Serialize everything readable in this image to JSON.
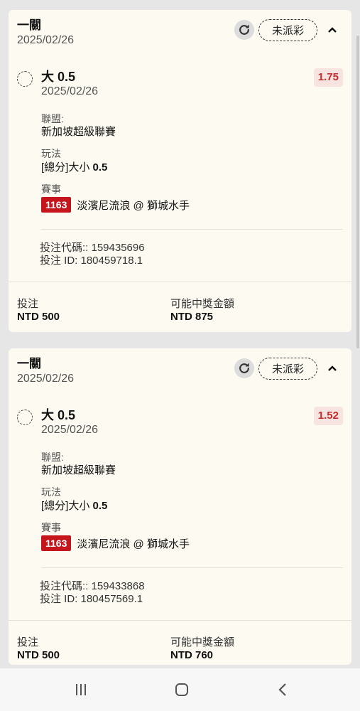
{
  "bets": [
    {
      "title": "一關",
      "date": "2025/02/26",
      "status": "未派彩",
      "selection": "大 0.5",
      "selection_date": "2025/02/26",
      "odds": "1.75",
      "league_label": "聯盟:",
      "league": "新加坡超級聯賽",
      "market_label": "玩法",
      "market_prefix": "[總分]大小",
      "market_value": "0.5",
      "event_label": "賽事",
      "event_id": "1163",
      "event_name": "淡濱尼流浪 @ 獅城水手",
      "bet_code": "投注代碼:: 159435696",
      "bet_id": "投注 ID: 180459718.1",
      "stake_label": "投注",
      "stake": "NTD 500",
      "payout_label": "可能中獎金額",
      "payout": "NTD 875"
    },
    {
      "title": "一關",
      "date": "2025/02/26",
      "status": "未派彩",
      "selection": "大 0.5",
      "selection_date": "2025/02/26",
      "odds": "1.52",
      "league_label": "聯盟:",
      "league": "新加坡超級聯賽",
      "market_label": "玩法",
      "market_prefix": "[總分]大小",
      "market_value": "0.5",
      "event_label": "賽事",
      "event_id": "1163",
      "event_name": "淡濱尼流浪 @ 獅城水手",
      "bet_code": "投注代碼:: 159433868",
      "bet_id": "投注 ID: 180457569.1",
      "stake_label": "投注",
      "stake": "NTD 500",
      "payout_label": "可能中獎金額",
      "payout": "NTD 760"
    }
  ],
  "colors": {
    "accent_red": "#c5161d",
    "odds_text": "#c52b2b",
    "card_bg": "#fcfaf1"
  },
  "icons": {
    "refresh": "refresh-icon",
    "collapse": "chevron-up-icon",
    "nav_recent": "recent-apps-icon",
    "nav_home": "home-icon",
    "nav_back": "back-icon"
  }
}
